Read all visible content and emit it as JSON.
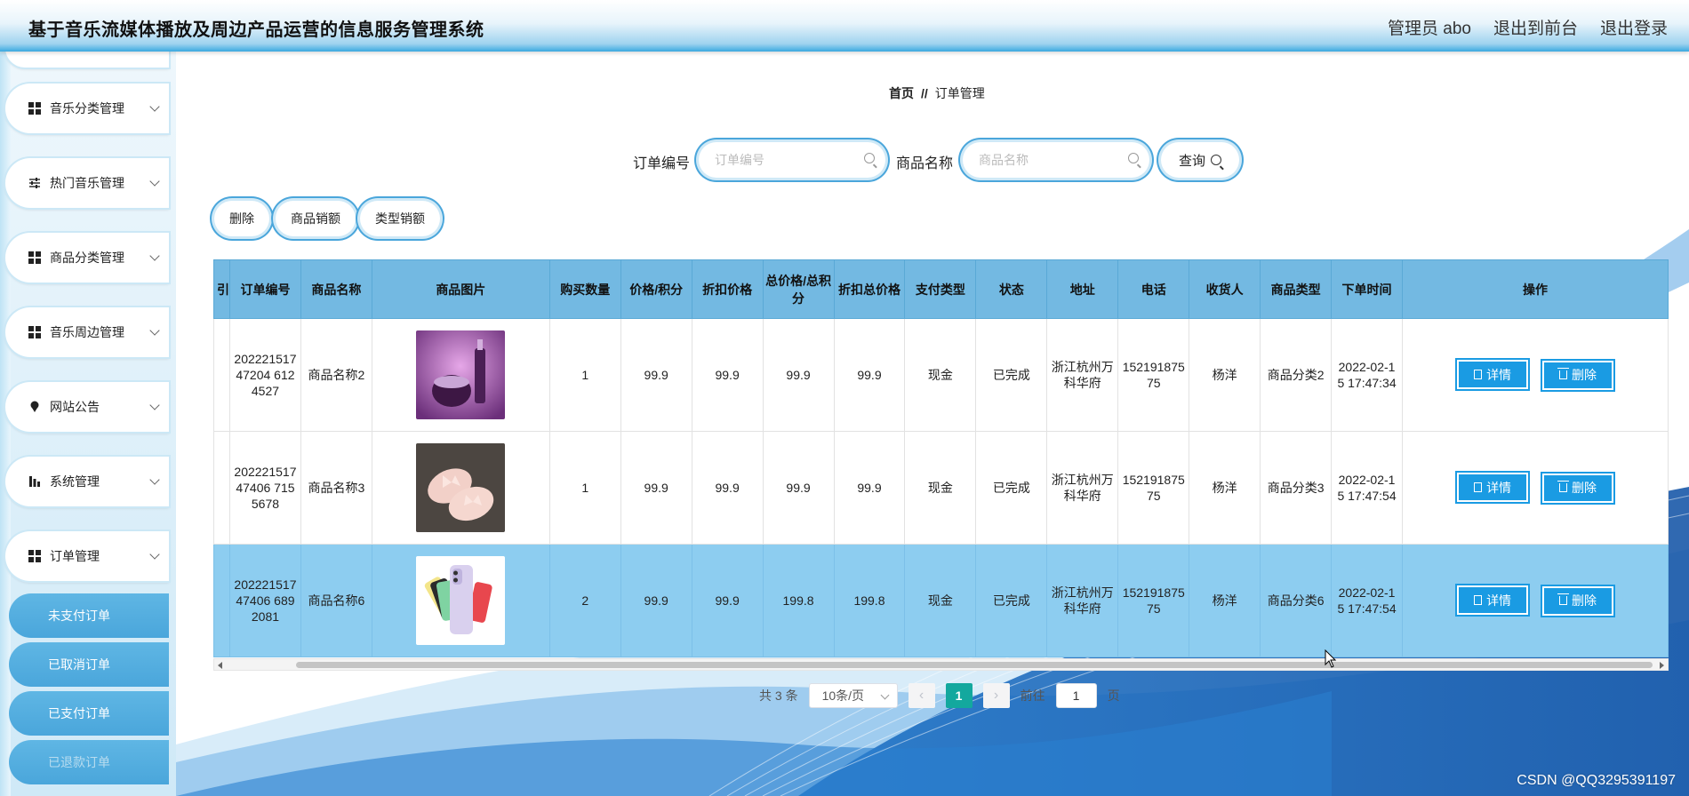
{
  "header": {
    "title": "基于音乐流媒体播放及周边产品运营的信息服务管理系统",
    "admin": "管理员 abo",
    "to_front": "退出到前台",
    "logout": "退出登录"
  },
  "sidebar": {
    "items": [
      {
        "label": "音乐分类管理",
        "icon": "grid-icon"
      },
      {
        "label": "热门音乐管理",
        "icon": "sliders-icon"
      },
      {
        "label": "商品分类管理",
        "icon": "grid-icon"
      },
      {
        "label": "音乐周边管理",
        "icon": "grid-icon"
      },
      {
        "label": "网站公告",
        "icon": "pin-icon"
      },
      {
        "label": "系统管理",
        "icon": "chart-icon"
      },
      {
        "label": "订单管理",
        "icon": "grid-icon"
      }
    ],
    "sub_items": [
      "未支付订单",
      "已取消订单",
      "已支付订单",
      "已退款订单"
    ]
  },
  "breadcrumb": {
    "home": "首页",
    "sep": "//",
    "current": "订单管理"
  },
  "search": {
    "order_label": "订单编号",
    "order_placeholder": "订单编号",
    "product_label": "商品名称",
    "product_placeholder": "商品名称",
    "query_label": "查询"
  },
  "actions": {
    "delete": "删除",
    "product_sales": "商品销额",
    "type_sales": "类型销额"
  },
  "table": {
    "columns": [
      "引",
      "订单编号",
      "商品名称",
      "商品图片",
      "购买数量",
      "价格/积分",
      "折扣价格",
      "总价格/总积分",
      "折扣总价格",
      "支付类型",
      "状态",
      "地址",
      "电话",
      "收货人",
      "商品类型",
      "下单时间",
      "操作"
    ],
    "rows": [
      {
        "order_no": "20222151747204 6124527",
        "name": "商品名称2",
        "image": "cosmetics",
        "qty": "1",
        "price": "99.9",
        "discount": "99.9",
        "total": "99.9",
        "discount_total": "99.9",
        "pay": "现金",
        "status": "已完成",
        "address": "浙江杭州万科华府",
        "phone": "15219187575",
        "receiver": "杨洋",
        "type": "商品分类2",
        "time": "2022-02-15 17:47:34"
      },
      {
        "order_no": "20222151747406 7155678",
        "name": "商品名称3",
        "image": "shoes",
        "qty": "1",
        "price": "99.9",
        "discount": "99.9",
        "total": "99.9",
        "discount_total": "99.9",
        "pay": "现金",
        "status": "已完成",
        "address": "浙江杭州万科华府",
        "phone": "15219187575",
        "receiver": "杨洋",
        "type": "商品分类3",
        "time": "2022-02-15 17:47:54"
      },
      {
        "order_no": "20222151747406 6892081",
        "name": "商品名称6",
        "image": "phone",
        "qty": "2",
        "price": "99.9",
        "discount": "99.9",
        "total": "199.8",
        "discount_total": "199.8",
        "pay": "现金",
        "status": "已完成",
        "address": "浙江杭州万科华府",
        "phone": "15219187575",
        "receiver": "杨洋",
        "type": "商品分类6",
        "time": "2022-02-15 17:47:54"
      }
    ],
    "detail_label": "详情",
    "delete_label": "删除"
  },
  "pager": {
    "total": "共 3 条",
    "size": "10条/页",
    "current": "1",
    "goto_prefix": "前往",
    "goto_value": "1",
    "goto_suffix": "页"
  },
  "watermark": "CSDN @QQ3295391197",
  "colors": {
    "accent": "#4aa6db",
    "header_th": "#73b9e2",
    "row_highlight": "#8dcdf0",
    "button": "#1a9be3",
    "pager_active": "#13a89e"
  }
}
